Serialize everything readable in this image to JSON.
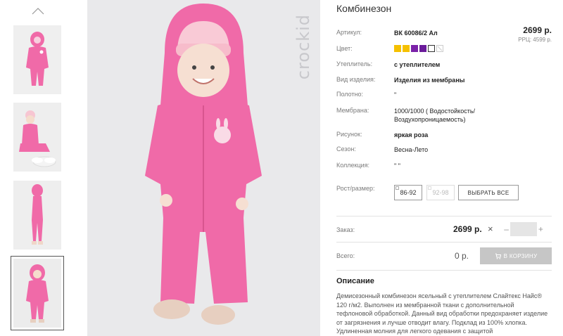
{
  "gallery": {
    "thumb_count": 4,
    "active_thumb": 3,
    "brand_watermark": "crockid"
  },
  "product": {
    "title": "Комбинезон",
    "price": "2699 р.",
    "rrc": "РРЦ: 4599 р.",
    "attributes": [
      {
        "label": "Артикул:",
        "value": "ВК 60086/2 Ал",
        "bold": true
      },
      {
        "label": "Цвет:",
        "value": ""
      },
      {
        "label": "Утеплитель:",
        "value": "с утеплителем",
        "bold": true
      },
      {
        "label": "Вид изделия:",
        "value": "Изделия из мембраны",
        "bold": true
      },
      {
        "label": "Полотно:",
        "value": "\""
      },
      {
        "label": "Мембрана:",
        "value": "1000/1000 ( Водостойкость/ Воздухопроницаемость)"
      },
      {
        "label": "Рисунок:",
        "value": "яркая роза",
        "bold": true
      },
      {
        "label": "Сезон:",
        "value": "Весна-Лето"
      },
      {
        "label": "Коллекция:",
        "value": "\" \""
      }
    ],
    "colors": [
      {
        "hex": "#f5c000",
        "selected": false,
        "disabled": false
      },
      {
        "hex": "#f5c000",
        "selected": false,
        "disabled": false
      },
      {
        "hex": "#7b22a8",
        "selected": false,
        "disabled": false
      },
      {
        "hex": "#6a1b9a",
        "selected": false,
        "disabled": false
      },
      {
        "hex": "#ffffff",
        "selected": true,
        "disabled": false
      },
      {
        "hex": "#ffffff",
        "selected": false,
        "disabled": true
      }
    ],
    "size_label": "Рост/размер:",
    "sizes": [
      {
        "label": "86-92",
        "disabled": false
      },
      {
        "label": "92-98",
        "disabled": true
      }
    ],
    "select_all": "ВЫБРАТЬ ВСЕ"
  },
  "order": {
    "label": "Заказ:",
    "price": "2699 р.",
    "times": "×",
    "minus": "–",
    "plus": "+",
    "total_label": "Всего:",
    "total_value": "0 р.",
    "cart_button": "В КОРЗИНУ"
  },
  "description": {
    "heading": "Описание",
    "text": "Демисезонный комбинезон ясельный с утеплителем Слайтекс Найс® 120 г/м2. Выполнен из мембранной ткани с дополнительной тефлоновой обработкой. Данный вид обработки предохраняет изделие от загрязнения и лучше отводит влагу. Подклад из 100% хлопка. Удлиненная молния для легкого одевания с защитой"
  },
  "colors": {
    "suit_pink": "#f06aa8",
    "hat_pink": "#f7c6d2",
    "background": "#e9e9eb"
  }
}
